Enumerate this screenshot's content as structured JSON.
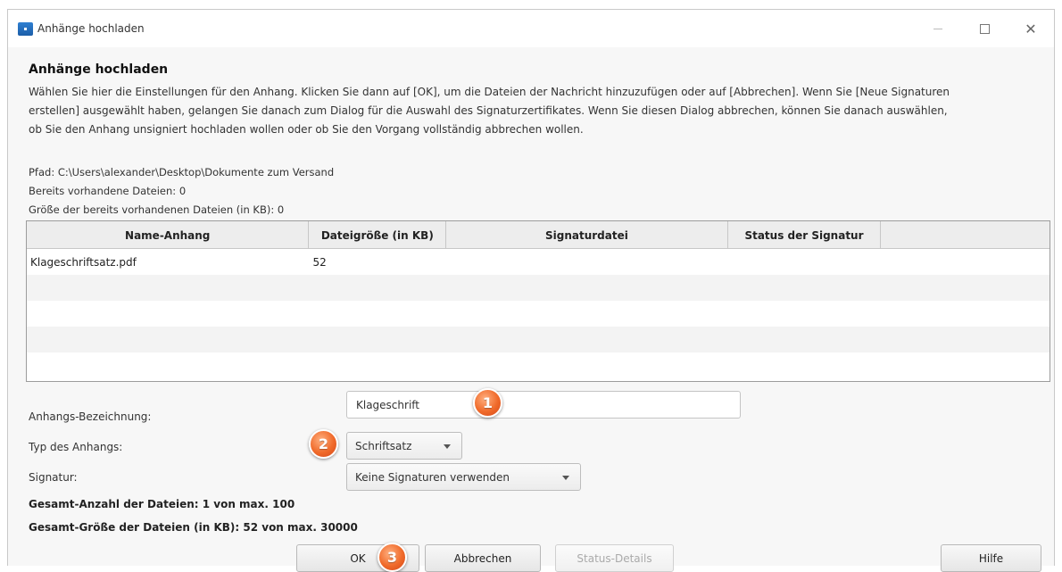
{
  "window": {
    "title": "Anhänge hochladen",
    "icon": "app-icon",
    "controls": [
      "minimize-icon",
      "maximize-icon",
      "close-icon"
    ]
  },
  "dialog": {
    "heading": "Anhänge hochladen",
    "intro_lines": [
      "Wählen Sie hier die Einstellungen für den Anhang. Klicken Sie dann auf [OK], um die Dateien der Nachricht hinzuzufügen oder auf [Abbrechen]. Wenn Sie [Neue Signaturen",
      "erstellen] ausgewählt haben, gelangen Sie danach zum Dialog für die Auswahl des Signaturzertifikates. Wenn Sie diesen Dialog abbrechen, können Sie danach auswählen,",
      "ob Sie den Anhang unsigniert hochladen wollen oder ob Sie den Vorgang vollständig abbrechen wollen."
    ],
    "path": "Pfad: C:\\Users\\alexander\\Desktop\\Dokumente zum Versand",
    "existing_files": "Bereits vorhandene Dateien: 0",
    "existing_size": "Größe der bereits vorhandenen Dateien (in KB): 0"
  },
  "table": {
    "columns": [
      "Name-Anhang",
      "Dateigröße (in KB)",
      "Signaturdatei",
      "Status der Signatur",
      ""
    ],
    "rows": [
      [
        "Klageschriftsatz.pdf",
        "52",
        "",
        "",
        ""
      ]
    ]
  },
  "form": {
    "name_label": "Anhangs-Bezeichnung:",
    "name_value": "Klageschrift",
    "type_label": "Typ des Anhangs:",
    "type_value": "Schriftsatz",
    "signature_label": "Signatur:",
    "signature_value": "Keine Signaturen verwenden",
    "total_count": "Gesamt-Anzahl der Dateien: 1 von max. 100",
    "total_size": "Gesamt-Größe der Dateien (in KB): 52 von max. 30000"
  },
  "buttons": {
    "ok": "OK",
    "cancel": "Abbrechen",
    "status": "Status-Details",
    "help": "Hilfe"
  },
  "badges": [
    "1",
    "2",
    "3"
  ],
  "colors": {
    "badge": "#f06a2a",
    "app_icon": "#1c5ea8"
  }
}
